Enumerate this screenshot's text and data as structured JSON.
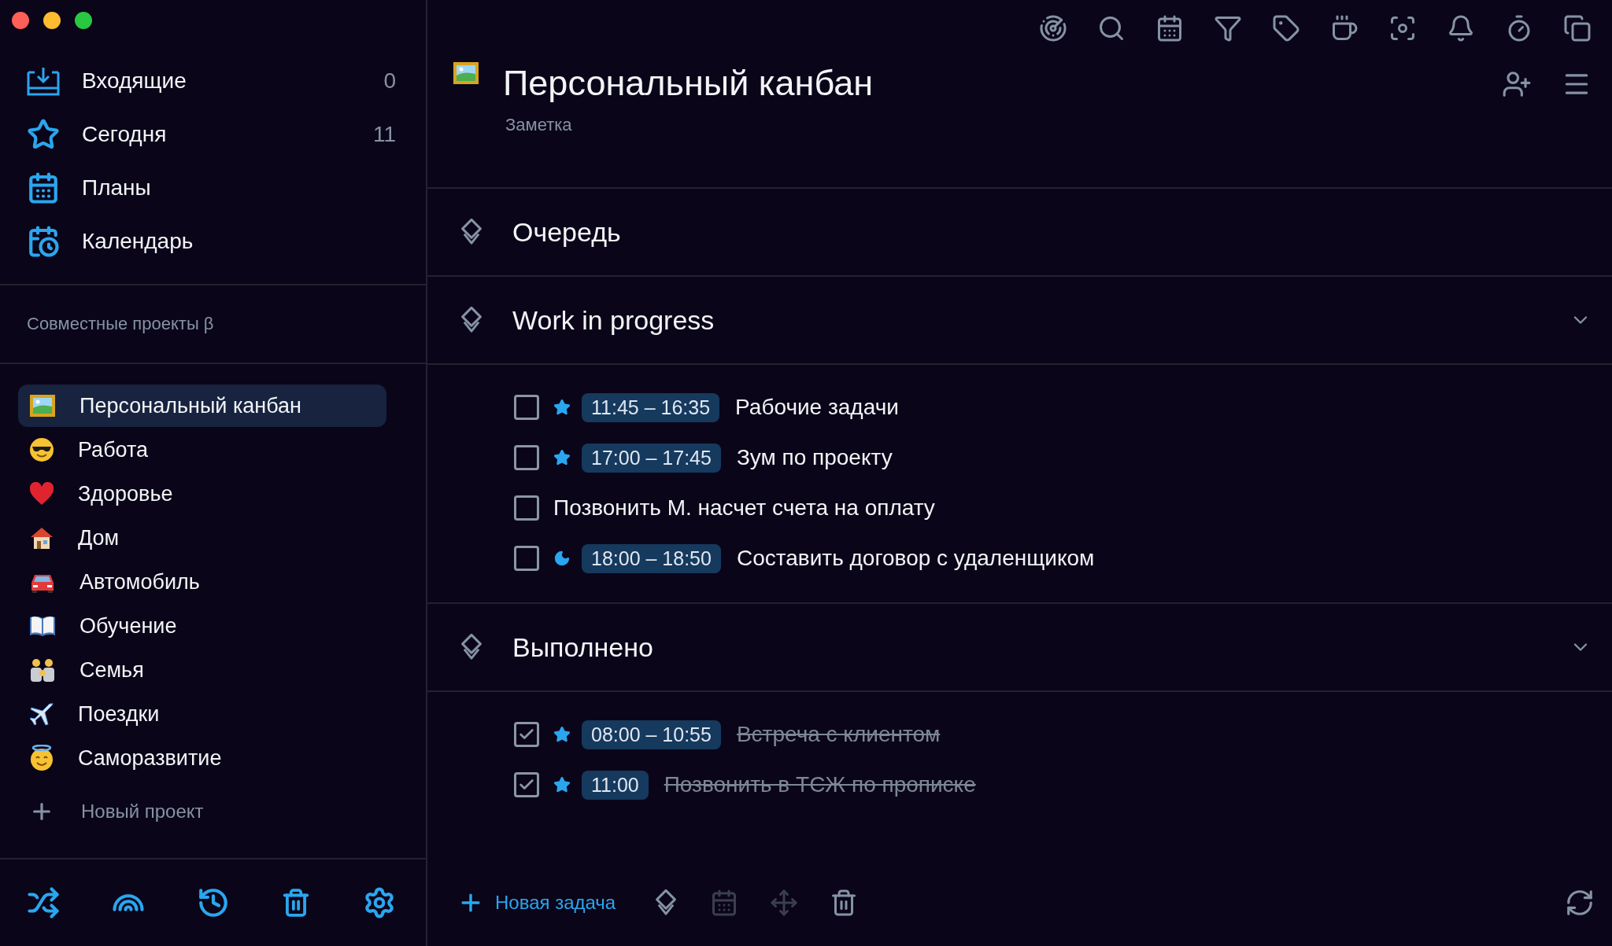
{
  "sidebar": {
    "nav": [
      {
        "label": "Входящие",
        "count": "0"
      },
      {
        "label": "Сегодня",
        "count": "11"
      },
      {
        "label": "Планы"
      },
      {
        "label": "Календарь"
      }
    ],
    "shared_title": "Совместные проекты β",
    "projects": [
      {
        "label": "Персональный канбан",
        "selected": true
      },
      {
        "label": "Работа",
        "selected": false
      },
      {
        "label": "Здоровье",
        "selected": false
      },
      {
        "label": "Дом",
        "selected": false
      },
      {
        "label": "Автомобиль",
        "selected": false
      },
      {
        "label": "Обучение",
        "selected": false
      },
      {
        "label": "Семья",
        "selected": false
      },
      {
        "label": "Поездки",
        "selected": false
      },
      {
        "label": "Саморазвитие",
        "selected": false
      }
    ],
    "new_project": "Новый проект"
  },
  "note": {
    "title": "Персональный канбан",
    "subtitle": "Заметка"
  },
  "groups": [
    {
      "title": "Очередь"
    },
    {
      "title": "Work in progress",
      "tasks": [
        {
          "checked": false,
          "starred": true,
          "evening": false,
          "time": "11:45 – 16:35",
          "title": "Рабочие задачи"
        },
        {
          "checked": false,
          "starred": true,
          "evening": false,
          "time": "17:00 – 17:45",
          "title": "Зум по проекту"
        },
        {
          "checked": false,
          "starred": false,
          "evening": false,
          "title": "Позвонить М. насчет счета на оплату"
        },
        {
          "checked": false,
          "starred": false,
          "evening": true,
          "time": "18:00 – 18:50",
          "title": "Составить договор с удаленщиком"
        }
      ]
    },
    {
      "title": "Выполнено",
      "tasks": [
        {
          "checked": true,
          "starred": true,
          "evening": false,
          "time": "08:00 – 10:55",
          "title": "Встреча с клиентом"
        },
        {
          "checked": true,
          "starred": true,
          "evening": false,
          "time": "11:00",
          "title": "Позвонить в ТСЖ по прописке"
        }
      ]
    }
  ],
  "bottom_bar": {
    "new_task": "Новая задача"
  }
}
